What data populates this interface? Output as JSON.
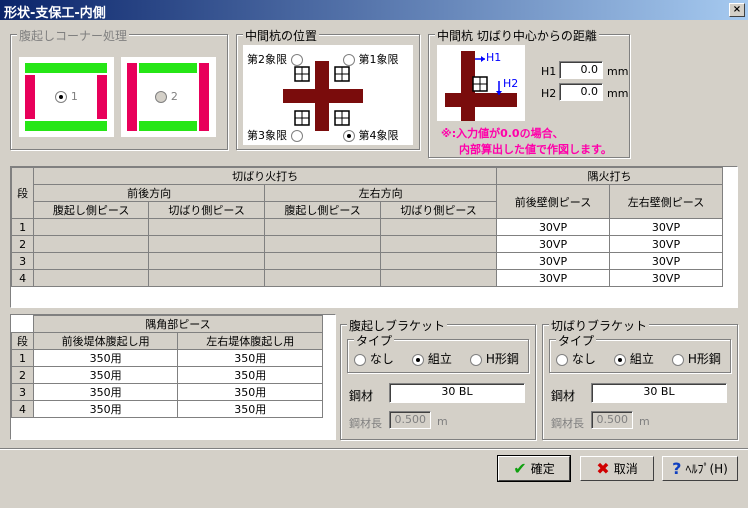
{
  "window": {
    "title": "形状-支保工-内側",
    "close": "×"
  },
  "corner": {
    "title": "腹起しコーナー処理",
    "opt1": "1",
    "opt2": "2",
    "selected": "1"
  },
  "pile_pos": {
    "title": "中間杭の位置",
    "q2": "第2象限",
    "q1": "第1象限",
    "q3": "第3象限",
    "q4": "第4象限",
    "selected": "第4象限"
  },
  "pile_dist": {
    "title": "中間杭 切ばり中心からの距離",
    "h1_label": "H1",
    "h2_label": "H2",
    "h1_value": "0.0",
    "h2_value": "0.0",
    "unit": "mm",
    "note1": "※:入力値が0.0の場合、",
    "note2": "内部算出した値で作図します。",
    "img_h1": "H1",
    "img_h2": "H2"
  },
  "main_table": {
    "dan": "段",
    "kiribari": "切ばり火打ち",
    "zengo": "前後方向",
    "sayu": "左右方向",
    "harakoshi_piece": "腹起し側ピース",
    "kiribari_piece": "切ばり側ピース",
    "sumi": "隅火打ち",
    "zengo_wall": "前後壁側ピース",
    "sayu_wall": "左右壁側ピース",
    "rows": [
      {
        "n": "1",
        "zw": "30VP",
        "sw": "30VP"
      },
      {
        "n": "2",
        "zw": "30VP",
        "sw": "30VP"
      },
      {
        "n": "3",
        "zw": "30VP",
        "sw": "30VP"
      },
      {
        "n": "4",
        "zw": "30VP",
        "sw": "30VP"
      }
    ]
  },
  "corner_table": {
    "title": "隅角部ピース",
    "dan": "段",
    "col1": "前後堤体腹起し用",
    "col2": "左右堤体腹起し用",
    "rows": [
      {
        "n": "1",
        "a": "350用",
        "b": "350用"
      },
      {
        "n": "2",
        "a": "350用",
        "b": "350用"
      },
      {
        "n": "3",
        "a": "350用",
        "b": "350用"
      },
      {
        "n": "4",
        "a": "350用",
        "b": "350用"
      }
    ]
  },
  "hara_bracket": {
    "title": "腹起しブラケット",
    "type": "タイプ",
    "none": "なし",
    "kumi": "組立",
    "h": "H形鋼",
    "selected": "組立",
    "kouzai_label": "鋼材",
    "kouzai": "30 BL",
    "len_label": "鋼材長",
    "len": "0.500",
    "len_unit": "m"
  },
  "kiri_bracket": {
    "title": "切ばりブラケット",
    "type": "タイプ",
    "none": "なし",
    "kumi": "組立",
    "h": "H形鋼",
    "selected": "組立",
    "kouzai_label": "鋼材",
    "kouzai": "30 BL",
    "len_label": "鋼材長",
    "len": "0.500",
    "len_unit": "m"
  },
  "buttons": {
    "ok": "確定",
    "cancel": "取消",
    "help": "ﾍﾙﾌﾟ(H)"
  },
  "colors": {
    "accent_red": "#e8005a",
    "green": "#26e616",
    "beam": "#7a0c0c",
    "note": "#ff00aa"
  }
}
